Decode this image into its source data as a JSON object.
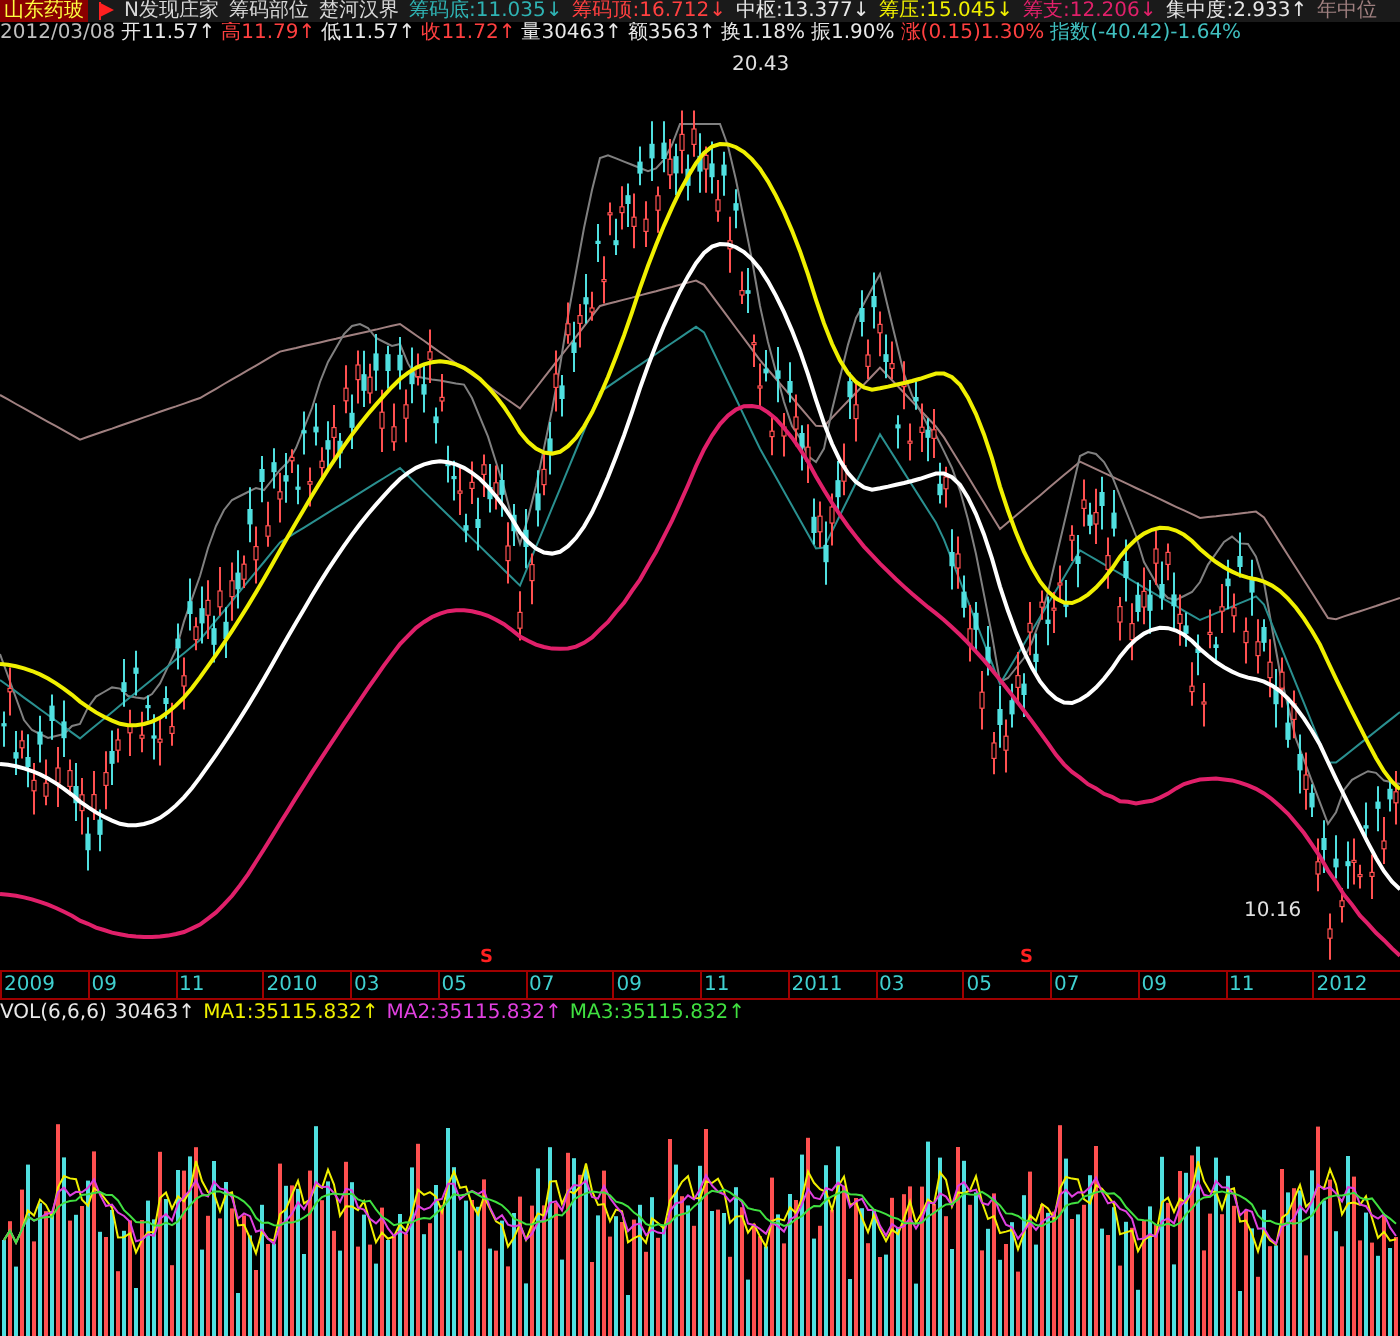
{
  "header": {
    "stock": "山东药玻",
    "indicators": [
      {
        "text": "N发现庄家",
        "color": "#d8d8d8"
      },
      {
        "text": "筹码部位",
        "color": "#d8d8d8"
      },
      {
        "text": "楚河汉界",
        "color": "#d8d8d8"
      },
      {
        "text": "筹码底:11.035↓",
        "color": "#2fb3b3"
      },
      {
        "text": "筹码顶:16.712↓",
        "color": "#ff4040"
      },
      {
        "text": "中枢:13.377↓",
        "color": "#e8e8e8"
      },
      {
        "text": "筹压:15.045↓",
        "color": "#f0f000"
      },
      {
        "text": "筹支:12.206↓",
        "color": "#e0206a"
      },
      {
        "text": "集中度:2.933↑",
        "color": "#e8e8e8"
      },
      {
        "text": "年中位",
        "color": "#a08080"
      }
    ]
  },
  "quote": [
    {
      "text": "2012/03/08",
      "color": "#c0c0c0"
    },
    {
      "text": "开11.57↑",
      "color": "#e8e8e8"
    },
    {
      "text": "高11.79↑",
      "color": "#ff4040"
    },
    {
      "text": "低11.57↑",
      "color": "#e8e8e8"
    },
    {
      "text": "收11.72↑",
      "color": "#ff4040"
    },
    {
      "text": "量30463↑",
      "color": "#e8e8e8"
    },
    {
      "text": "额3563↑",
      "color": "#e8e8e8"
    },
    {
      "text": "换1.18%",
      "color": "#e8e8e8"
    },
    {
      "text": "振1.90%",
      "color": "#e8e8e8"
    },
    {
      "text": "涨(0.15)1.30%",
      "color": "#ff4040"
    },
    {
      "text": "指数(-40.42)-1.64%",
      "color": "#40c0c0"
    }
  ],
  "price_chart": {
    "high_label": "20.43",
    "low_label": "10.16",
    "signal_marks": [
      "S",
      "S"
    ]
  },
  "time_axis": [
    "2009",
    "09",
    "11",
    "2010",
    "03",
    "05",
    "07",
    "09",
    "11",
    "2011",
    "03",
    "05",
    "07",
    "09",
    "11",
    "2012"
  ],
  "volume_legend": [
    {
      "text": "VOL(6,6,6)",
      "color": "#e8e8e8"
    },
    {
      "text": "30463↑",
      "color": "#e8e8e8"
    },
    {
      "text": "MA1:35115.832↑",
      "color": "#f0f000"
    },
    {
      "text": "MA2:35115.832↑",
      "color": "#e040e0"
    },
    {
      "text": "MA3:35115.832↑",
      "color": "#40e040"
    }
  ]
}
